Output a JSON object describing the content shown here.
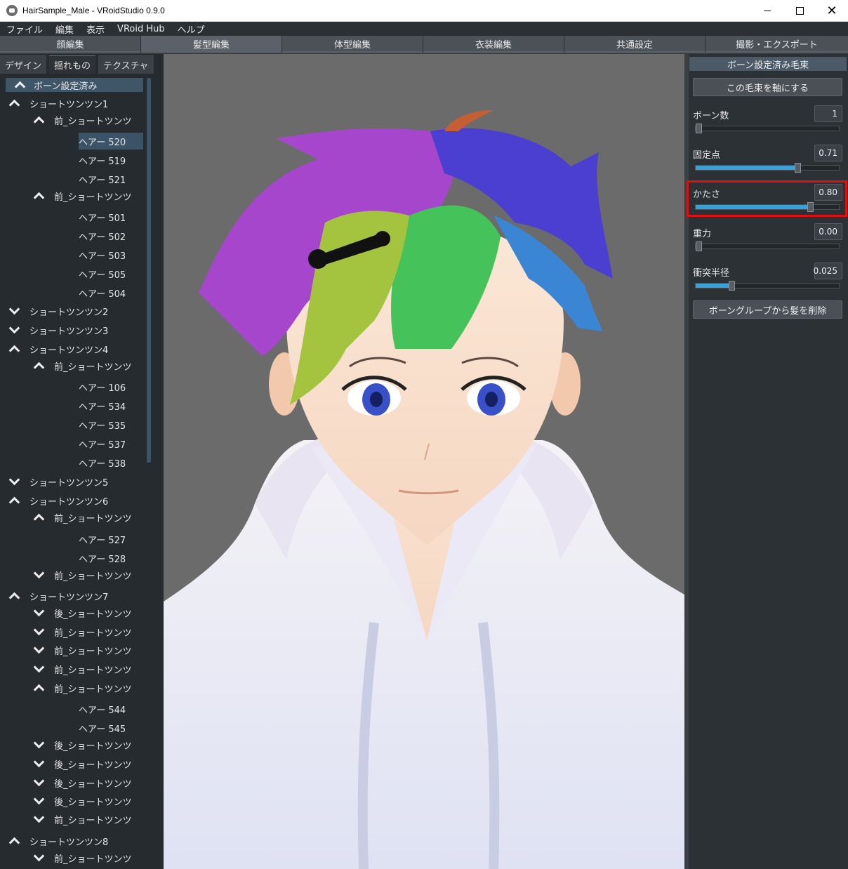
{
  "window": {
    "title": "HairSample_Male - VRoidStudio 0.9.0",
    "min": "",
    "max": "",
    "close": "✕"
  },
  "menu": [
    "ファイル",
    "編集",
    "表示",
    "VRoid Hub",
    "ヘルプ"
  ],
  "main_tabs": [
    "顔編集",
    "髪型編集",
    "体型編集",
    "衣装編集",
    "共通設定",
    "撮影・エクスポート"
  ],
  "left": {
    "sub_tabs": [
      "デザイン",
      "揺れもの",
      "テクスチャ"
    ],
    "tree_header": "ボーン設定済み",
    "rows": [
      {
        "label": "ショートツンツン1",
        "level": 0,
        "chev": "up"
      },
      {
        "label": "前_ショートツンツ",
        "level": 1,
        "chev": "up"
      },
      {
        "label": "ヘアー 520",
        "level": 2,
        "chev": "",
        "selected": true
      },
      {
        "label": "ヘアー 519",
        "level": 2,
        "chev": ""
      },
      {
        "label": "ヘアー 521",
        "level": 2,
        "chev": ""
      },
      {
        "label": "前_ショートツンツ",
        "level": 1,
        "chev": "up"
      },
      {
        "label": "ヘアー 501",
        "level": 2,
        "chev": ""
      },
      {
        "label": "ヘアー 502",
        "level": 2,
        "chev": ""
      },
      {
        "label": "ヘアー 503",
        "level": 2,
        "chev": ""
      },
      {
        "label": "ヘアー 505",
        "level": 2,
        "chev": ""
      },
      {
        "label": "ヘアー 504",
        "level": 2,
        "chev": ""
      },
      {
        "label": "ショートツンツン2",
        "level": 0,
        "chev": "down"
      },
      {
        "label": "ショートツンツン3",
        "level": 0,
        "chev": "down"
      },
      {
        "label": "ショートツンツン4",
        "level": 0,
        "chev": "up"
      },
      {
        "label": "前_ショートツンツ",
        "level": 1,
        "chev": "up"
      },
      {
        "label": "ヘアー 106",
        "level": 2,
        "chev": ""
      },
      {
        "label": "ヘアー 534",
        "level": 2,
        "chev": ""
      },
      {
        "label": "ヘアー 535",
        "level": 2,
        "chev": ""
      },
      {
        "label": "ヘアー 537",
        "level": 2,
        "chev": ""
      },
      {
        "label": "ヘアー 538",
        "level": 2,
        "chev": ""
      },
      {
        "label": "ショートツンツン5",
        "level": 0,
        "chev": "down"
      },
      {
        "label": "ショートツンツン6",
        "level": 0,
        "chev": "up"
      },
      {
        "label": "前_ショートツンツ",
        "level": 1,
        "chev": "up"
      },
      {
        "label": "ヘアー 527",
        "level": 2,
        "chev": ""
      },
      {
        "label": "ヘアー 528",
        "level": 2,
        "chev": ""
      },
      {
        "label": "前_ショートツンツ",
        "level": 1,
        "chev": "down"
      },
      {
        "label": "ショートツンツン7",
        "level": 0,
        "chev": "up"
      },
      {
        "label": "後_ショートツンツ",
        "level": 1,
        "chev": "down"
      },
      {
        "label": "前_ショートツンツ",
        "level": 1,
        "chev": "down"
      },
      {
        "label": "前_ショートツンツ",
        "level": 1,
        "chev": "down"
      },
      {
        "label": "前_ショートツンツ",
        "level": 1,
        "chev": "down"
      },
      {
        "label": "前_ショートツンツ",
        "level": 1,
        "chev": "up"
      },
      {
        "label": "ヘアー 544",
        "level": 2,
        "chev": ""
      },
      {
        "label": "ヘアー 545",
        "level": 2,
        "chev": ""
      },
      {
        "label": "後_ショートツンツ",
        "level": 1,
        "chev": "down"
      },
      {
        "label": "後_ショートツンツ",
        "level": 1,
        "chev": "down"
      },
      {
        "label": "後_ショートツンツ",
        "level": 1,
        "chev": "down"
      },
      {
        "label": "後_ショートツンツ",
        "level": 1,
        "chev": "down"
      },
      {
        "label": "前_ショートツンツ",
        "level": 1,
        "chev": "down"
      },
      {
        "label": "ショートツンツン8",
        "level": 0,
        "chev": "up"
      },
      {
        "label": "前_ショートツンツ",
        "level": 1,
        "chev": "down"
      }
    ]
  },
  "right": {
    "header": "ボーン設定済み毛束",
    "axis_button": "この毛束を軸にする",
    "params": [
      {
        "label": "ボーン数",
        "value": "1",
        "fraction": 0.0
      },
      {
        "label": "固定点",
        "value": "0.71",
        "fraction": 0.71
      },
      {
        "label": "かたさ",
        "value": "0.80",
        "fraction": 0.8
      },
      {
        "label": "重力",
        "value": "0.00",
        "fraction": 0.0
      },
      {
        "label": "衝突半径",
        "value": "0.025",
        "fraction": 0.25
      }
    ],
    "remove_button": "ボーングループから髪を削除"
  },
  "colors": {
    "accent": "#3aa0d8",
    "highlight": "#e01010",
    "viewport_bg": "#6b6b6b"
  }
}
